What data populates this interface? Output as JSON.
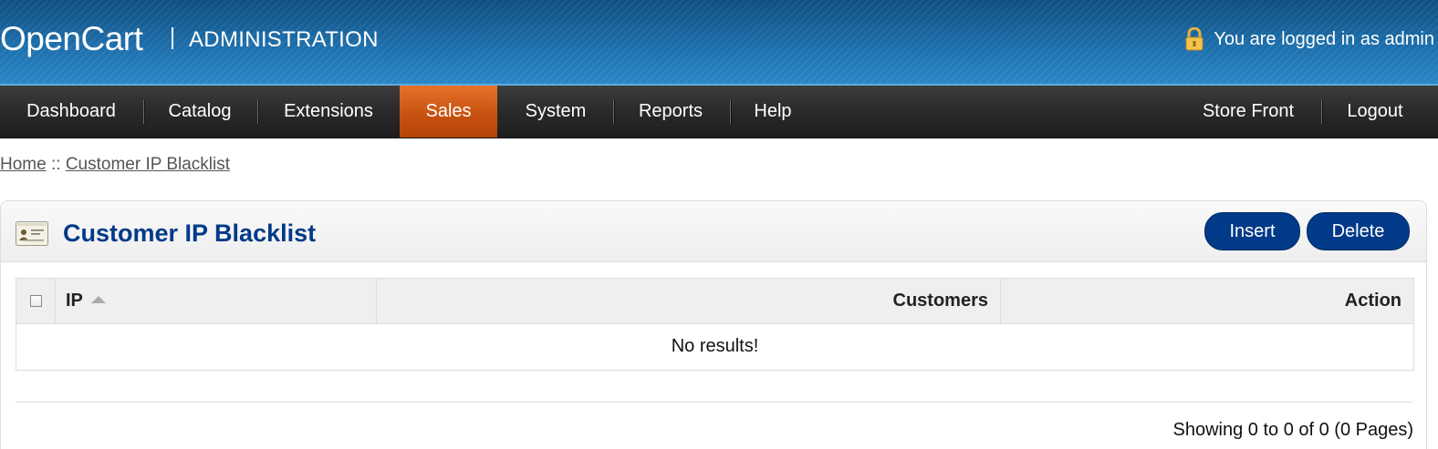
{
  "header": {
    "logo": "OpenCart",
    "subtitle": "ADMINISTRATION",
    "logged_in_text": "You are logged in as admin"
  },
  "nav": {
    "left": [
      "Dashboard",
      "Catalog",
      "Extensions",
      "Sales",
      "System",
      "Reports",
      "Help"
    ],
    "active": "Sales",
    "right": [
      "Store Front",
      "Logout"
    ]
  },
  "breadcrumb": {
    "home": "Home",
    "separator": "::",
    "current": "Customer IP Blacklist"
  },
  "panel": {
    "title": "Customer IP Blacklist",
    "insert_label": "Insert",
    "delete_label": "Delete"
  },
  "table": {
    "columns": [
      "IP",
      "Customers",
      "Action"
    ],
    "empty_message": "No results!"
  },
  "pagination": {
    "text": "Showing 0 to 0 of 0 (0 Pages)"
  },
  "colors": {
    "header_blue": "#1b6aa3",
    "active_tab": "#c55010",
    "button_blue": "#003a88"
  }
}
